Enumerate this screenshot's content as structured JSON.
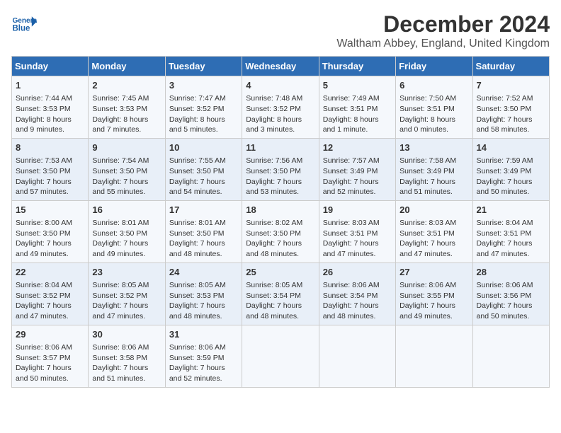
{
  "header": {
    "logo_text_general": "General",
    "logo_text_blue": "Blue",
    "title": "December 2024",
    "subtitle": "Waltham Abbey, England, United Kingdom"
  },
  "calendar": {
    "columns": [
      "Sunday",
      "Monday",
      "Tuesday",
      "Wednesday",
      "Thursday",
      "Friday",
      "Saturday"
    ],
    "rows": [
      [
        {
          "day": "1",
          "info": "Sunrise: 7:44 AM\nSunset: 3:53 PM\nDaylight: 8 hours\nand 9 minutes."
        },
        {
          "day": "2",
          "info": "Sunrise: 7:45 AM\nSunset: 3:53 PM\nDaylight: 8 hours\nand 7 minutes."
        },
        {
          "day": "3",
          "info": "Sunrise: 7:47 AM\nSunset: 3:52 PM\nDaylight: 8 hours\nand 5 minutes."
        },
        {
          "day": "4",
          "info": "Sunrise: 7:48 AM\nSunset: 3:52 PM\nDaylight: 8 hours\nand 3 minutes."
        },
        {
          "day": "5",
          "info": "Sunrise: 7:49 AM\nSunset: 3:51 PM\nDaylight: 8 hours\nand 1 minute."
        },
        {
          "day": "6",
          "info": "Sunrise: 7:50 AM\nSunset: 3:51 PM\nDaylight: 8 hours\nand 0 minutes."
        },
        {
          "day": "7",
          "info": "Sunrise: 7:52 AM\nSunset: 3:50 PM\nDaylight: 7 hours\nand 58 minutes."
        }
      ],
      [
        {
          "day": "8",
          "info": "Sunrise: 7:53 AM\nSunset: 3:50 PM\nDaylight: 7 hours\nand 57 minutes."
        },
        {
          "day": "9",
          "info": "Sunrise: 7:54 AM\nSunset: 3:50 PM\nDaylight: 7 hours\nand 55 minutes."
        },
        {
          "day": "10",
          "info": "Sunrise: 7:55 AM\nSunset: 3:50 PM\nDaylight: 7 hours\nand 54 minutes."
        },
        {
          "day": "11",
          "info": "Sunrise: 7:56 AM\nSunset: 3:50 PM\nDaylight: 7 hours\nand 53 minutes."
        },
        {
          "day": "12",
          "info": "Sunrise: 7:57 AM\nSunset: 3:49 PM\nDaylight: 7 hours\nand 52 minutes."
        },
        {
          "day": "13",
          "info": "Sunrise: 7:58 AM\nSunset: 3:49 PM\nDaylight: 7 hours\nand 51 minutes."
        },
        {
          "day": "14",
          "info": "Sunrise: 7:59 AM\nSunset: 3:49 PM\nDaylight: 7 hours\nand 50 minutes."
        }
      ],
      [
        {
          "day": "15",
          "info": "Sunrise: 8:00 AM\nSunset: 3:50 PM\nDaylight: 7 hours\nand 49 minutes."
        },
        {
          "day": "16",
          "info": "Sunrise: 8:01 AM\nSunset: 3:50 PM\nDaylight: 7 hours\nand 49 minutes."
        },
        {
          "day": "17",
          "info": "Sunrise: 8:01 AM\nSunset: 3:50 PM\nDaylight: 7 hours\nand 48 minutes."
        },
        {
          "day": "18",
          "info": "Sunrise: 8:02 AM\nSunset: 3:50 PM\nDaylight: 7 hours\nand 48 minutes."
        },
        {
          "day": "19",
          "info": "Sunrise: 8:03 AM\nSunset: 3:51 PM\nDaylight: 7 hours\nand 47 minutes."
        },
        {
          "day": "20",
          "info": "Sunrise: 8:03 AM\nSunset: 3:51 PM\nDaylight: 7 hours\nand 47 minutes."
        },
        {
          "day": "21",
          "info": "Sunrise: 8:04 AM\nSunset: 3:51 PM\nDaylight: 7 hours\nand 47 minutes."
        }
      ],
      [
        {
          "day": "22",
          "info": "Sunrise: 8:04 AM\nSunset: 3:52 PM\nDaylight: 7 hours\nand 47 minutes."
        },
        {
          "day": "23",
          "info": "Sunrise: 8:05 AM\nSunset: 3:52 PM\nDaylight: 7 hours\nand 47 minutes."
        },
        {
          "day": "24",
          "info": "Sunrise: 8:05 AM\nSunset: 3:53 PM\nDaylight: 7 hours\nand 48 minutes."
        },
        {
          "day": "25",
          "info": "Sunrise: 8:05 AM\nSunset: 3:54 PM\nDaylight: 7 hours\nand 48 minutes."
        },
        {
          "day": "26",
          "info": "Sunrise: 8:06 AM\nSunset: 3:54 PM\nDaylight: 7 hours\nand 48 minutes."
        },
        {
          "day": "27",
          "info": "Sunrise: 8:06 AM\nSunset: 3:55 PM\nDaylight: 7 hours\nand 49 minutes."
        },
        {
          "day": "28",
          "info": "Sunrise: 8:06 AM\nSunset: 3:56 PM\nDaylight: 7 hours\nand 50 minutes."
        }
      ],
      [
        {
          "day": "29",
          "info": "Sunrise: 8:06 AM\nSunset: 3:57 PM\nDaylight: 7 hours\nand 50 minutes."
        },
        {
          "day": "30",
          "info": "Sunrise: 8:06 AM\nSunset: 3:58 PM\nDaylight: 7 hours\nand 51 minutes."
        },
        {
          "day": "31",
          "info": "Sunrise: 8:06 AM\nSunset: 3:59 PM\nDaylight: 7 hours\nand 52 minutes."
        },
        {
          "day": "",
          "info": ""
        },
        {
          "day": "",
          "info": ""
        },
        {
          "day": "",
          "info": ""
        },
        {
          "day": "",
          "info": ""
        }
      ]
    ]
  }
}
